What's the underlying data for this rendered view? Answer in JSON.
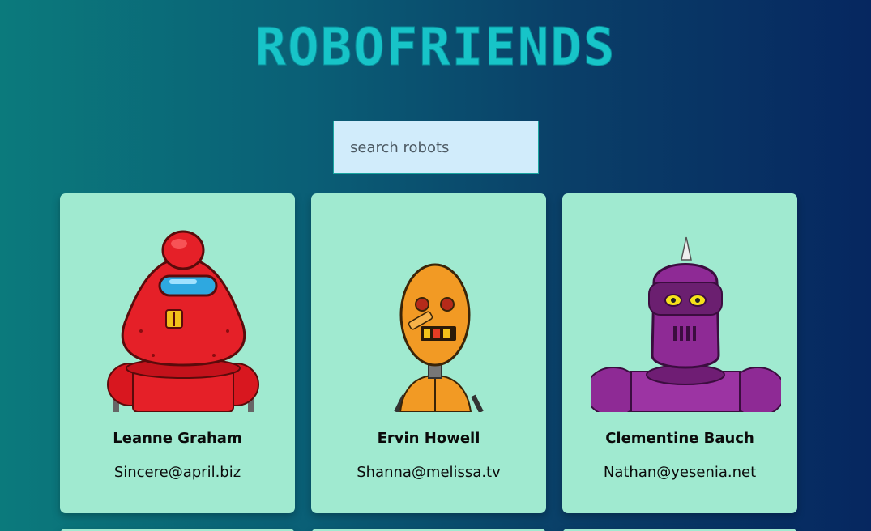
{
  "app": {
    "title": "ROBOFRIENDS"
  },
  "search": {
    "placeholder": "search robots",
    "value": ""
  },
  "robots": [
    {
      "name": "Leanne Graham",
      "email": "Sincere@april.biz",
      "color": "#e52028"
    },
    {
      "name": "Ervin Howell",
      "email": "Shanna@melissa.tv",
      "color": "#f29a24"
    },
    {
      "name": "Clementine Bauch",
      "email": "Nathan@yesenia.net",
      "color": "#8e2a95"
    }
  ],
  "colors": {
    "card_background": "#a0ead0",
    "title": "#17c4c8",
    "search_background": "#d1ecfb"
  }
}
